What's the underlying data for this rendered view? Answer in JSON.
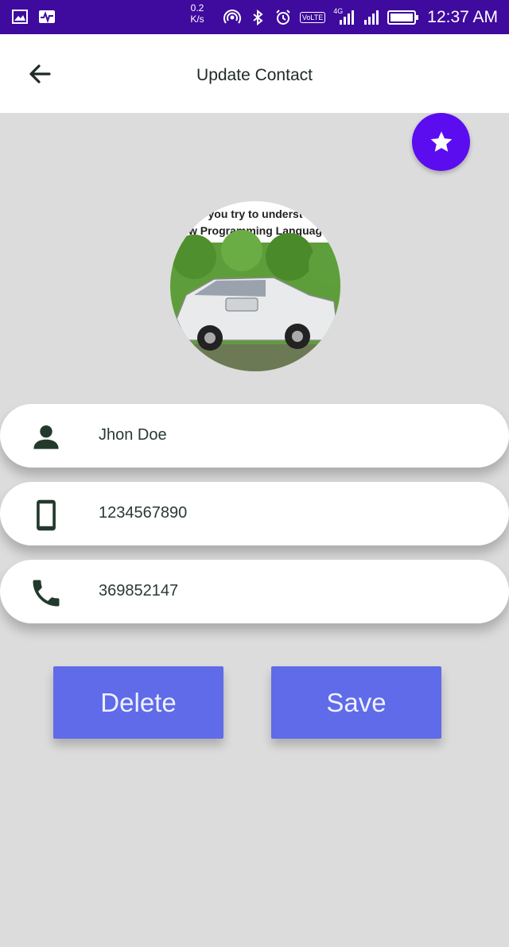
{
  "status_bar": {
    "speed_value": "0.2",
    "speed_unit": "K/s",
    "volte": "VoLTE",
    "network": "4G",
    "time": "12:37 AM",
    "bg_color": "#3f0a9e"
  },
  "app_bar": {
    "title": "Update Contact",
    "back_icon": "arrow-left-icon"
  },
  "favorite": {
    "icon": "star-icon",
    "color": "#5b0df0"
  },
  "avatar": {
    "caption_line1": "you try to underst",
    "caption_line2": "w Programming Languag"
  },
  "fields": [
    {
      "icon": "person-icon",
      "value": "Jhon Doe"
    },
    {
      "icon": "mobile-phone-icon",
      "value": "1234567890"
    },
    {
      "icon": "call-icon",
      "value": "369852147"
    }
  ],
  "actions": {
    "delete_label": "Delete",
    "save_label": "Save",
    "button_color": "#5f6be8"
  }
}
